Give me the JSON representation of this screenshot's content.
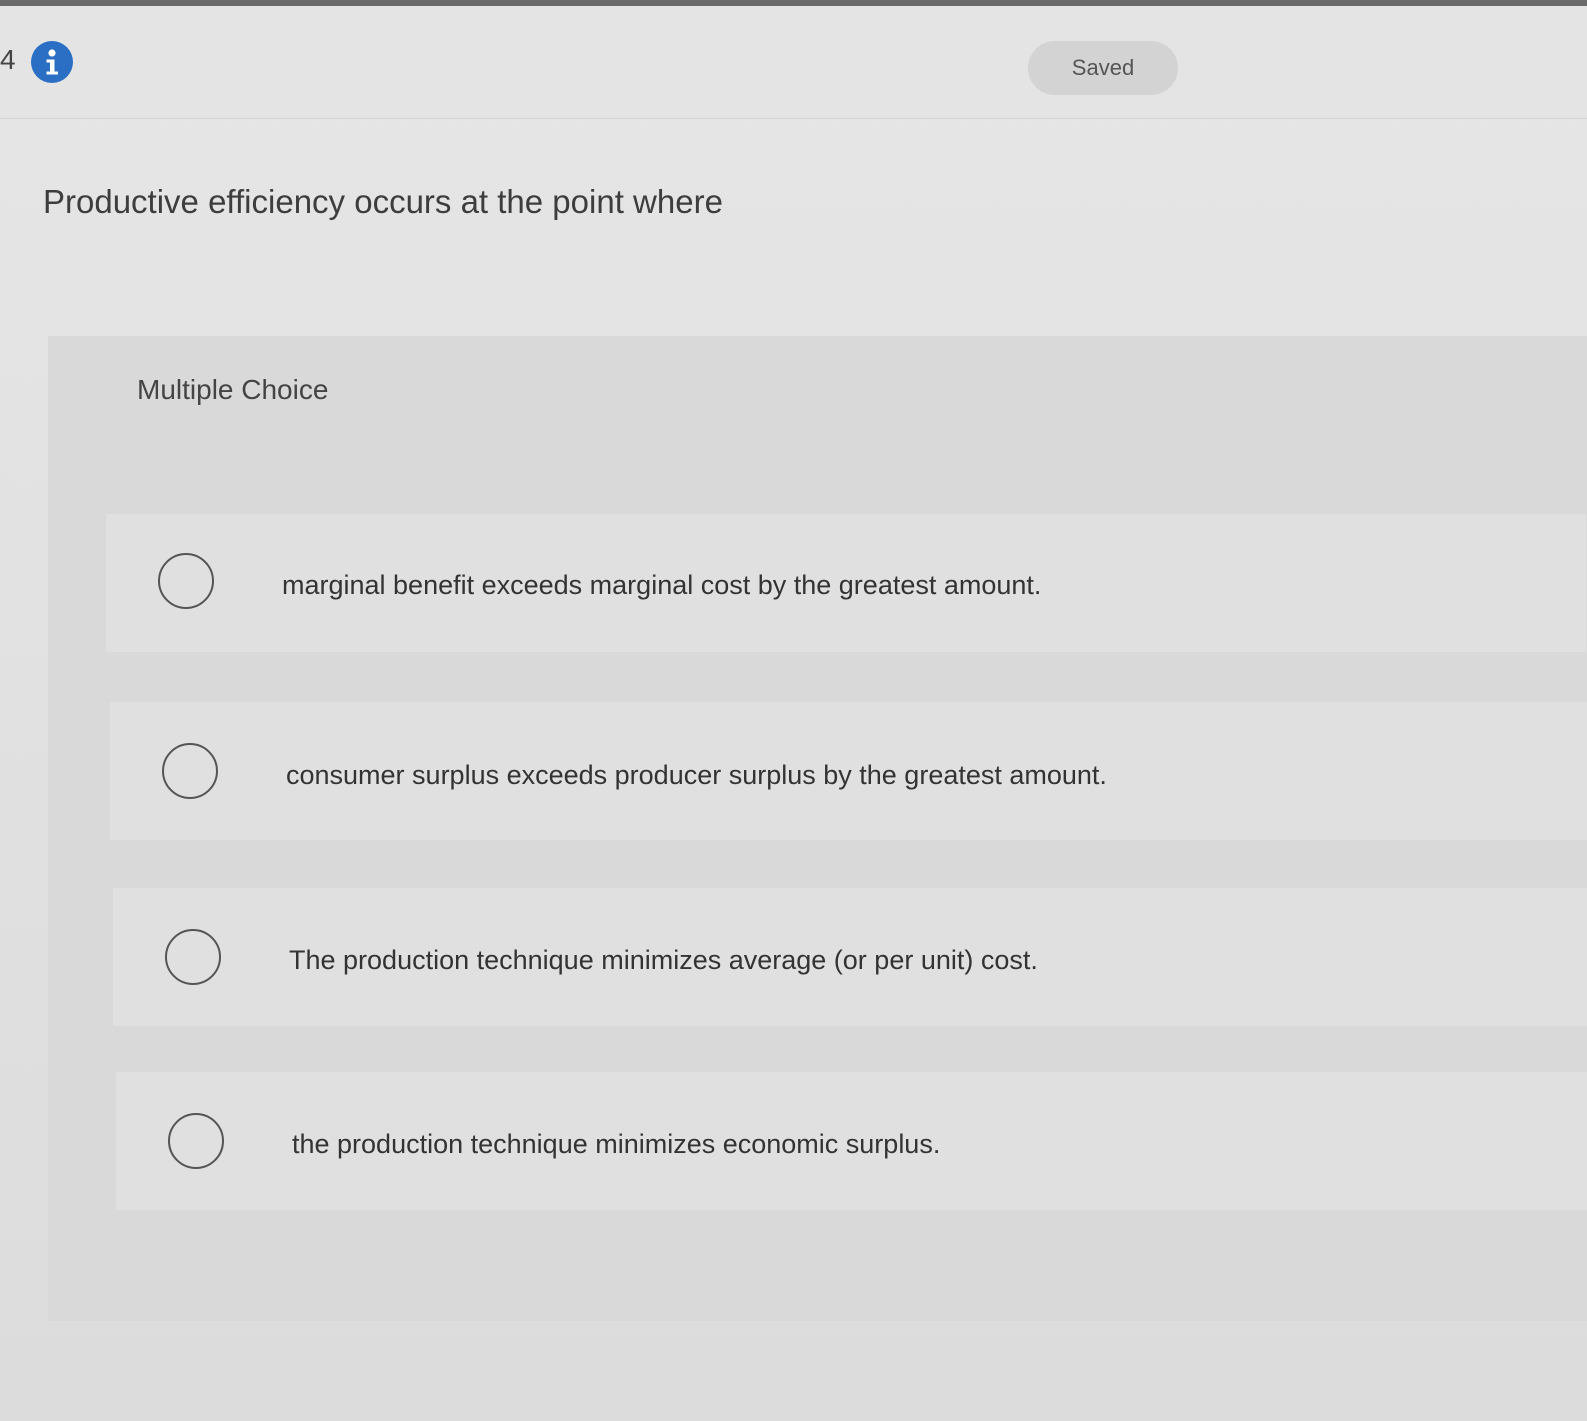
{
  "header": {
    "question_number": "4",
    "info_icon": "info-icon",
    "status": "Saved"
  },
  "question": {
    "prompt": "Productive efficiency occurs at the point where"
  },
  "choices": {
    "heading": "Multiple Choice",
    "options": [
      {
        "label": "marginal benefit exceeds marginal cost by the greatest amount.",
        "selected": false
      },
      {
        "label": "consumer surplus exceeds producer surplus by the greatest amount.",
        "selected": false
      },
      {
        "label": "The production technique minimizes average (or per unit) cost.",
        "selected": false
      },
      {
        "label": "the production technique minimizes economic surplus.",
        "selected": false
      }
    ]
  },
  "colors": {
    "info_icon": "#2a6fc4",
    "background": "#e4e4e4"
  }
}
